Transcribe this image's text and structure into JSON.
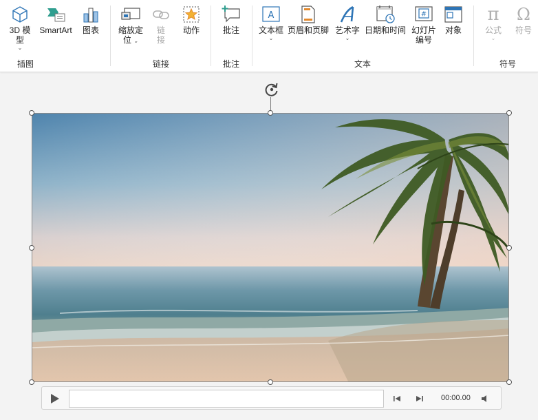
{
  "ribbon": {
    "groups": {
      "illustrations": {
        "label": "插图",
        "model3d": {
          "line1": "3D 模",
          "line2": "型",
          "caret": "⌄"
        },
        "smartart": {
          "label": "SmartArt"
        },
        "chart": {
          "label": "图表"
        }
      },
      "links": {
        "label": "链接",
        "zoom": {
          "line1": "缩放定",
          "line2": "位",
          "caret": "⌄"
        },
        "link": {
          "line1": "链",
          "line2": "接"
        },
        "action": {
          "label": "动作"
        }
      },
      "comments": {
        "label": "批注",
        "comment": {
          "label": "批注"
        }
      },
      "text": {
        "label": "文本",
        "textbox": {
          "label": "文本框",
          "caret": "⌄"
        },
        "header_footer": {
          "label": "页眉和页脚"
        },
        "wordart": {
          "label": "艺术字",
          "caret": "⌄"
        },
        "datetime": {
          "label": "日期和时间"
        },
        "slide_number": {
          "line1": "幻灯片",
          "line2": "编号"
        },
        "object": {
          "label": "对象"
        }
      },
      "symbols": {
        "label": "符号",
        "equation": {
          "label": "公式",
          "caret": "⌄"
        },
        "symbol": {
          "label": "符号"
        }
      }
    }
  },
  "media_player": {
    "time": "00:00.00",
    "progress": 0
  },
  "colors": {
    "accent_blue": "#2e75b6",
    "icon_teal": "#2f9e8f",
    "icon_orange": "#e3892c",
    "disabled": "#a8a8a8"
  }
}
